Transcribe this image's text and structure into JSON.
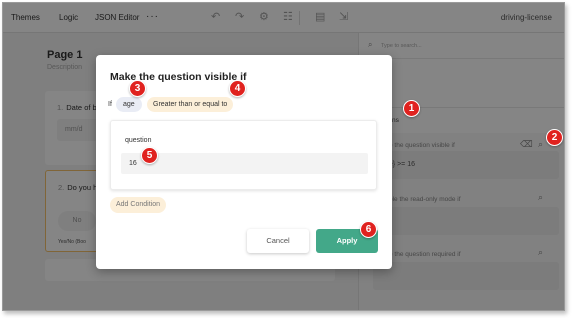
{
  "toolbar": {
    "tabs": [
      "Themes",
      "Logic",
      "JSON Editor"
    ],
    "more": "···",
    "icons": [
      "undo-icon",
      "redo-icon",
      "settings-icon",
      "clear-icon",
      "preview-icon",
      "expand-icon"
    ],
    "survey_name": "driving-license"
  },
  "designer": {
    "page_title": "Page 1",
    "page_description": "Description",
    "questions": [
      {
        "number": "1.",
        "title": "Date of b",
        "input_placeholder": "mm/d"
      },
      {
        "number": "2.",
        "title": "Do you h",
        "option": "No",
        "type_label": "Yes/No (Boo"
      }
    ]
  },
  "panel": {
    "search_placeholder": "Type to search...",
    "question_name": "l",
    "section_label": "ions",
    "visible_if_label": "e the question visible if",
    "visible_if_value": "ge} >= 16",
    "readonly_label": "ble the read-only mode if",
    "required_if_label": "e the question required if"
  },
  "dialog": {
    "title": "Make the question visible if",
    "if_label": "If",
    "question_chip": "age",
    "operator_chip": "Greater than or equal to",
    "card_label": "question",
    "value": "16",
    "add_condition": "Add Condition",
    "cancel": "Cancel",
    "apply": "Apply"
  },
  "callouts": [
    "1",
    "2",
    "3",
    "4",
    "5",
    "6"
  ],
  "colors": {
    "apply_button": "#43a889",
    "callout": "#e0221f",
    "operator_chip": "#fcefd9",
    "question_chip": "#e9ecf5",
    "selected_question_border": "#f5c26b"
  }
}
